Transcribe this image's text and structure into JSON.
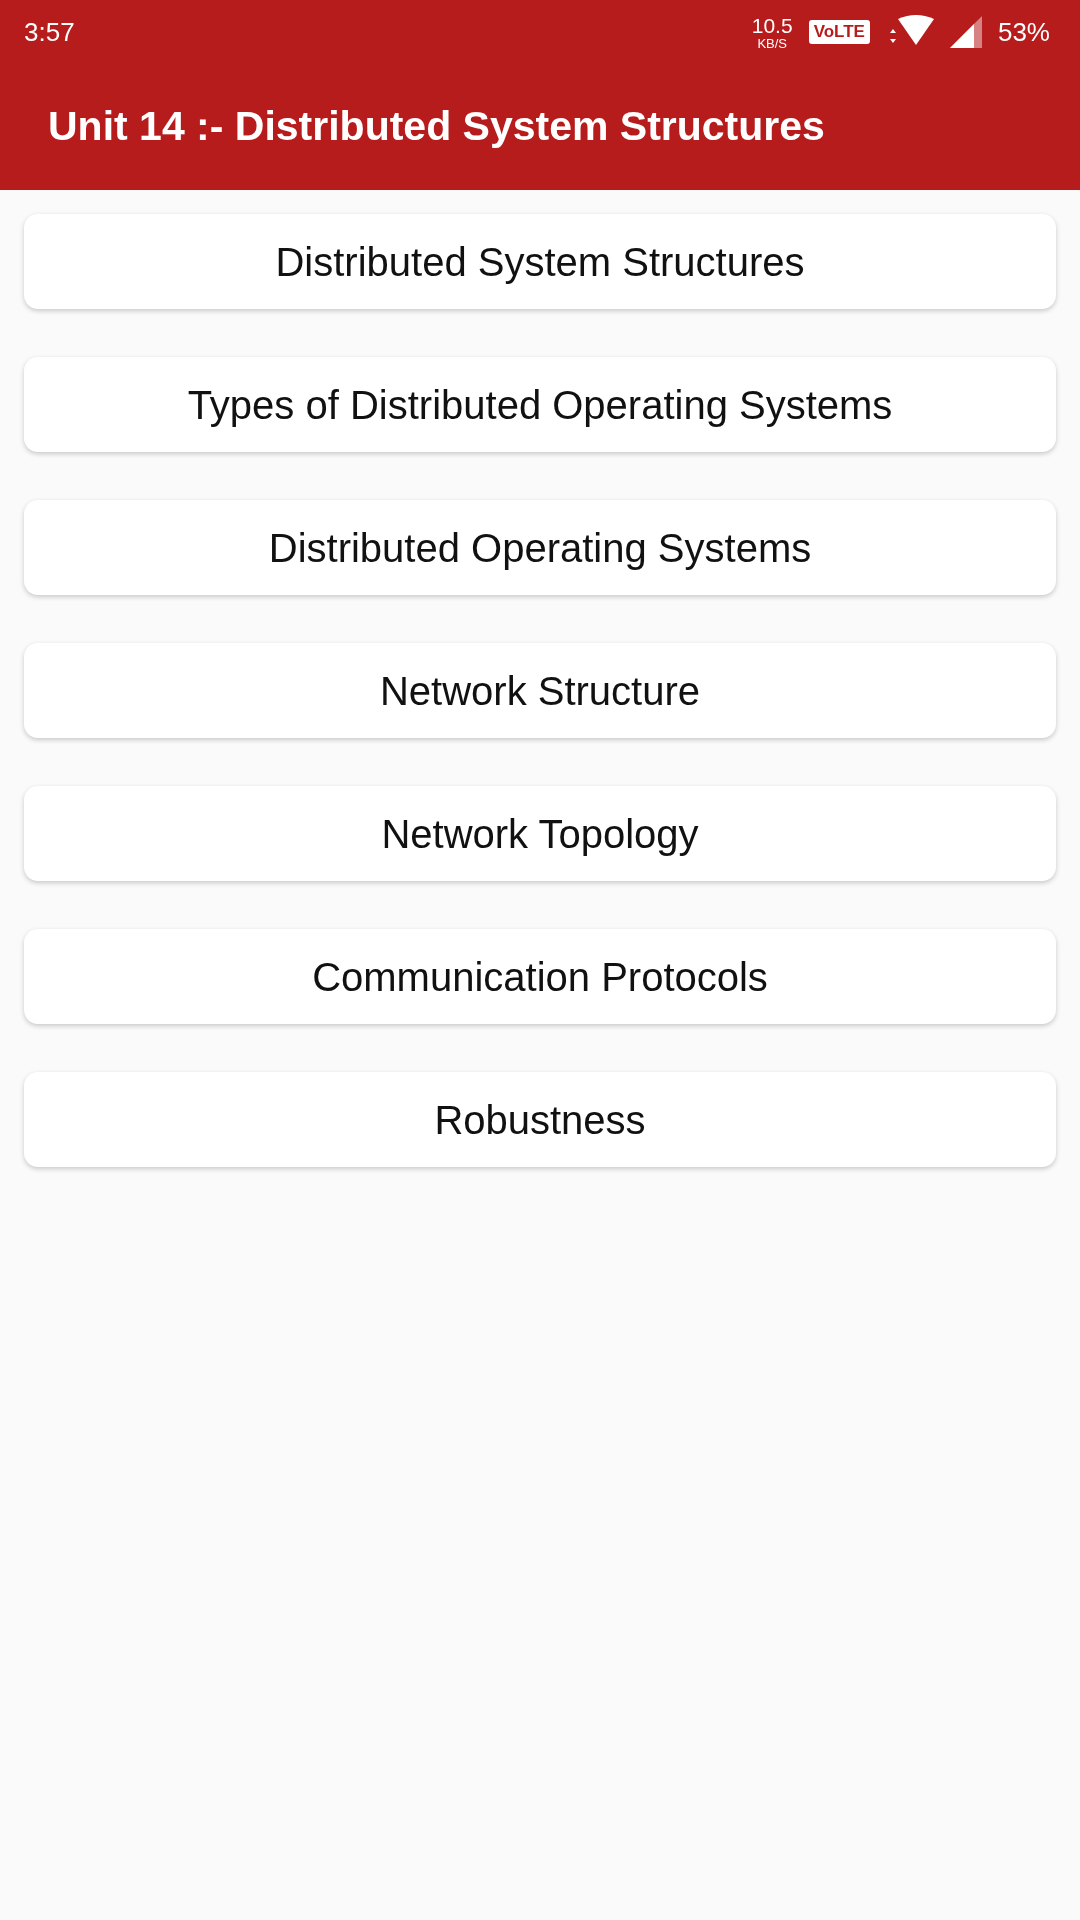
{
  "status_bar": {
    "time": "3:57",
    "net_speed": {
      "value": "10.5",
      "unit": "KB/S"
    },
    "volte_badge": "VoLTE",
    "battery": "53%"
  },
  "app_bar": {
    "title": "Unit 14 :- Distributed System Structures"
  },
  "topics": [
    {
      "label": "Distributed System Structures"
    },
    {
      "label": "Types of Distributed Operating Systems"
    },
    {
      "label": "Distributed Operating Systems"
    },
    {
      "label": "Network Structure"
    },
    {
      "label": "Network Topology"
    },
    {
      "label": "Communication Protocols"
    },
    {
      "label": "Robustness"
    }
  ]
}
